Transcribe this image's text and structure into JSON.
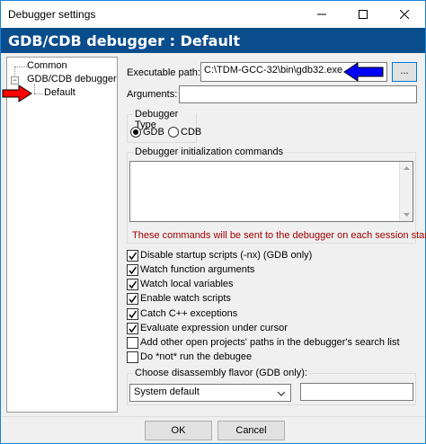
{
  "window": {
    "title": "Debugger settings"
  },
  "header": {
    "title": "GDB/CDB debugger : Default"
  },
  "tree": {
    "items": [
      {
        "label": "Common"
      },
      {
        "label": "GDB/CDB debugger"
      },
      {
        "label": "Default"
      }
    ]
  },
  "form": {
    "executable_label": "Executable path:",
    "executable_value": "C:\\TDM-GCC-32\\bin\\gdb32.exe",
    "browse_label": "...",
    "arguments_label": "Arguments:",
    "arguments_value": ""
  },
  "debugger_type": {
    "title": "Debugger Type",
    "options": [
      {
        "label": "GDB",
        "selected": true
      },
      {
        "label": "CDB",
        "selected": false
      }
    ]
  },
  "init_commands": {
    "title": "Debugger initialization commands",
    "value": "",
    "note": "These commands will be sent to the debugger on each session start"
  },
  "options": [
    {
      "label": "Disable startup scripts (-nx) (GDB only)",
      "checked": true
    },
    {
      "label": "Watch function arguments",
      "checked": true
    },
    {
      "label": "Watch local variables",
      "checked": true
    },
    {
      "label": "Enable watch scripts",
      "checked": true
    },
    {
      "label": "Catch C++ exceptions",
      "checked": true
    },
    {
      "label": "Evaluate expression under cursor",
      "checked": true
    },
    {
      "label": "Add other open projects' paths in the debugger's search list",
      "checked": false
    },
    {
      "label": "Do *not* run the debugee",
      "checked": false
    }
  ],
  "disassembly": {
    "title": "Choose disassembly flavor (GDB only):",
    "selected": "System default",
    "custom_value": ""
  },
  "footer": {
    "ok_label": "OK",
    "cancel_label": "Cancel"
  },
  "colors": {
    "header_bg": "#0a4d8c",
    "note_text": "#a00000",
    "arrow_blue": "#0000ff",
    "arrow_red": "#ff0000"
  }
}
